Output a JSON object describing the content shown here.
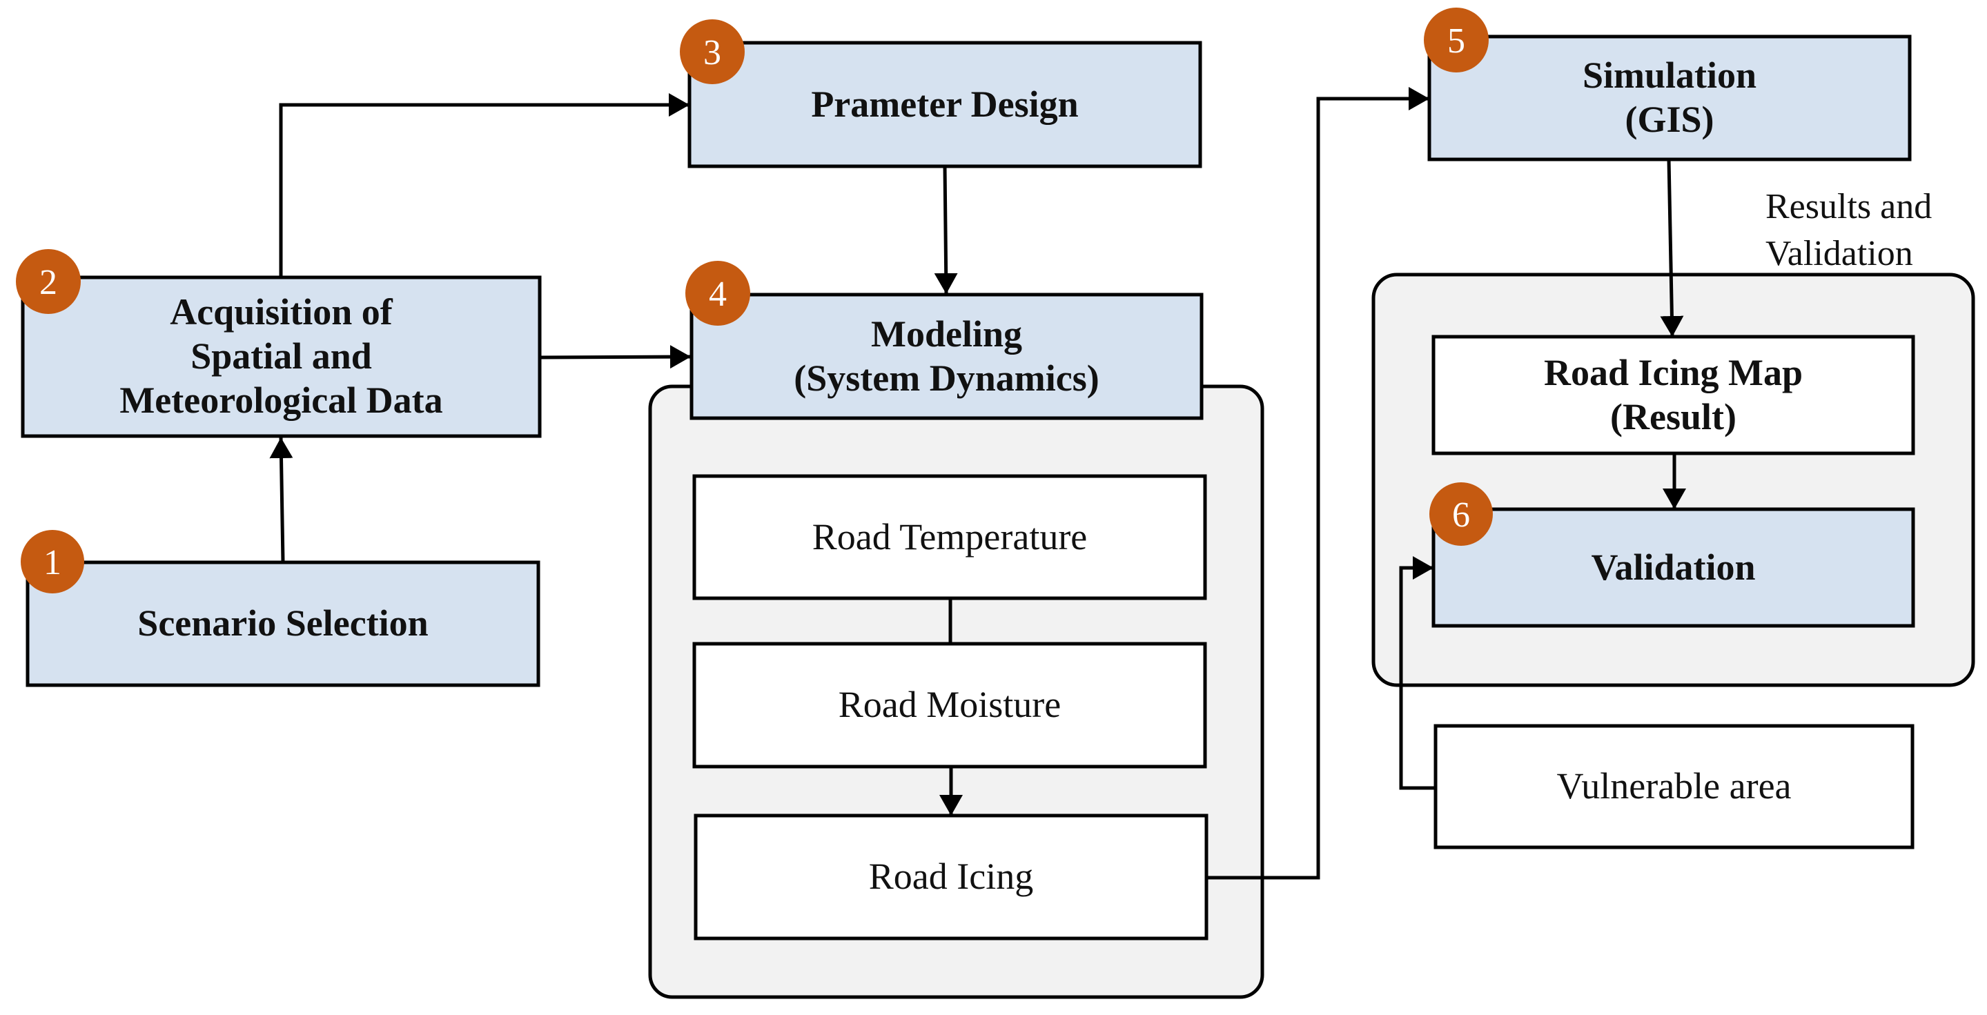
{
  "colors": {
    "step_box_fill": "#D6E2F0",
    "sub_box_fill": "#FFFFFF",
    "container_fill": "#F2F2F2",
    "badge_fill": "#C55A11",
    "stroke": "#000000"
  },
  "steps": [
    {
      "id": "scenario",
      "badge": "1",
      "label": "Scenario Selection"
    },
    {
      "id": "acquisition",
      "badge": "2",
      "label": "Acquisition of\nSpatial and\nMeteorological Data"
    },
    {
      "id": "parameter",
      "badge": "3",
      "label": "Prameter Design"
    },
    {
      "id": "modeling",
      "badge": "4",
      "label": "Modeling\n(System Dynamics)"
    },
    {
      "id": "simulation",
      "badge": "5",
      "label": "Simulation\n(GIS)"
    },
    {
      "id": "validation",
      "badge": "6",
      "label": "Validation"
    }
  ],
  "modeling_components": [
    {
      "id": "road-temperature",
      "label": "Road Temperature"
    },
    {
      "id": "road-moisture",
      "label": "Road Moisture"
    },
    {
      "id": "road-icing",
      "label": "Road Icing"
    }
  ],
  "results_group": {
    "title": "Results and\nValidation",
    "result_box": "Road Icing Map\n(Result)",
    "external_input": "Vulnerable area"
  },
  "connections": [
    {
      "from": "scenario",
      "to": "acquisition",
      "arrow": true
    },
    {
      "from": "acquisition",
      "to": "parameter",
      "arrow": true
    },
    {
      "from": "acquisition",
      "to": "modeling",
      "arrow": true
    },
    {
      "from": "parameter",
      "to": "modeling",
      "arrow": true
    },
    {
      "from": "road-temperature",
      "to": "road-moisture",
      "arrow": false
    },
    {
      "from": "road-moisture",
      "to": "road-icing",
      "arrow": true
    },
    {
      "from": "road-icing",
      "to": "simulation",
      "arrow": true
    },
    {
      "from": "simulation",
      "to": "road-icing-map",
      "arrow": true
    },
    {
      "from": "road-icing-map",
      "to": "validation",
      "arrow": true
    },
    {
      "from": "vulnerable-area",
      "to": "validation",
      "arrow": true
    }
  ]
}
